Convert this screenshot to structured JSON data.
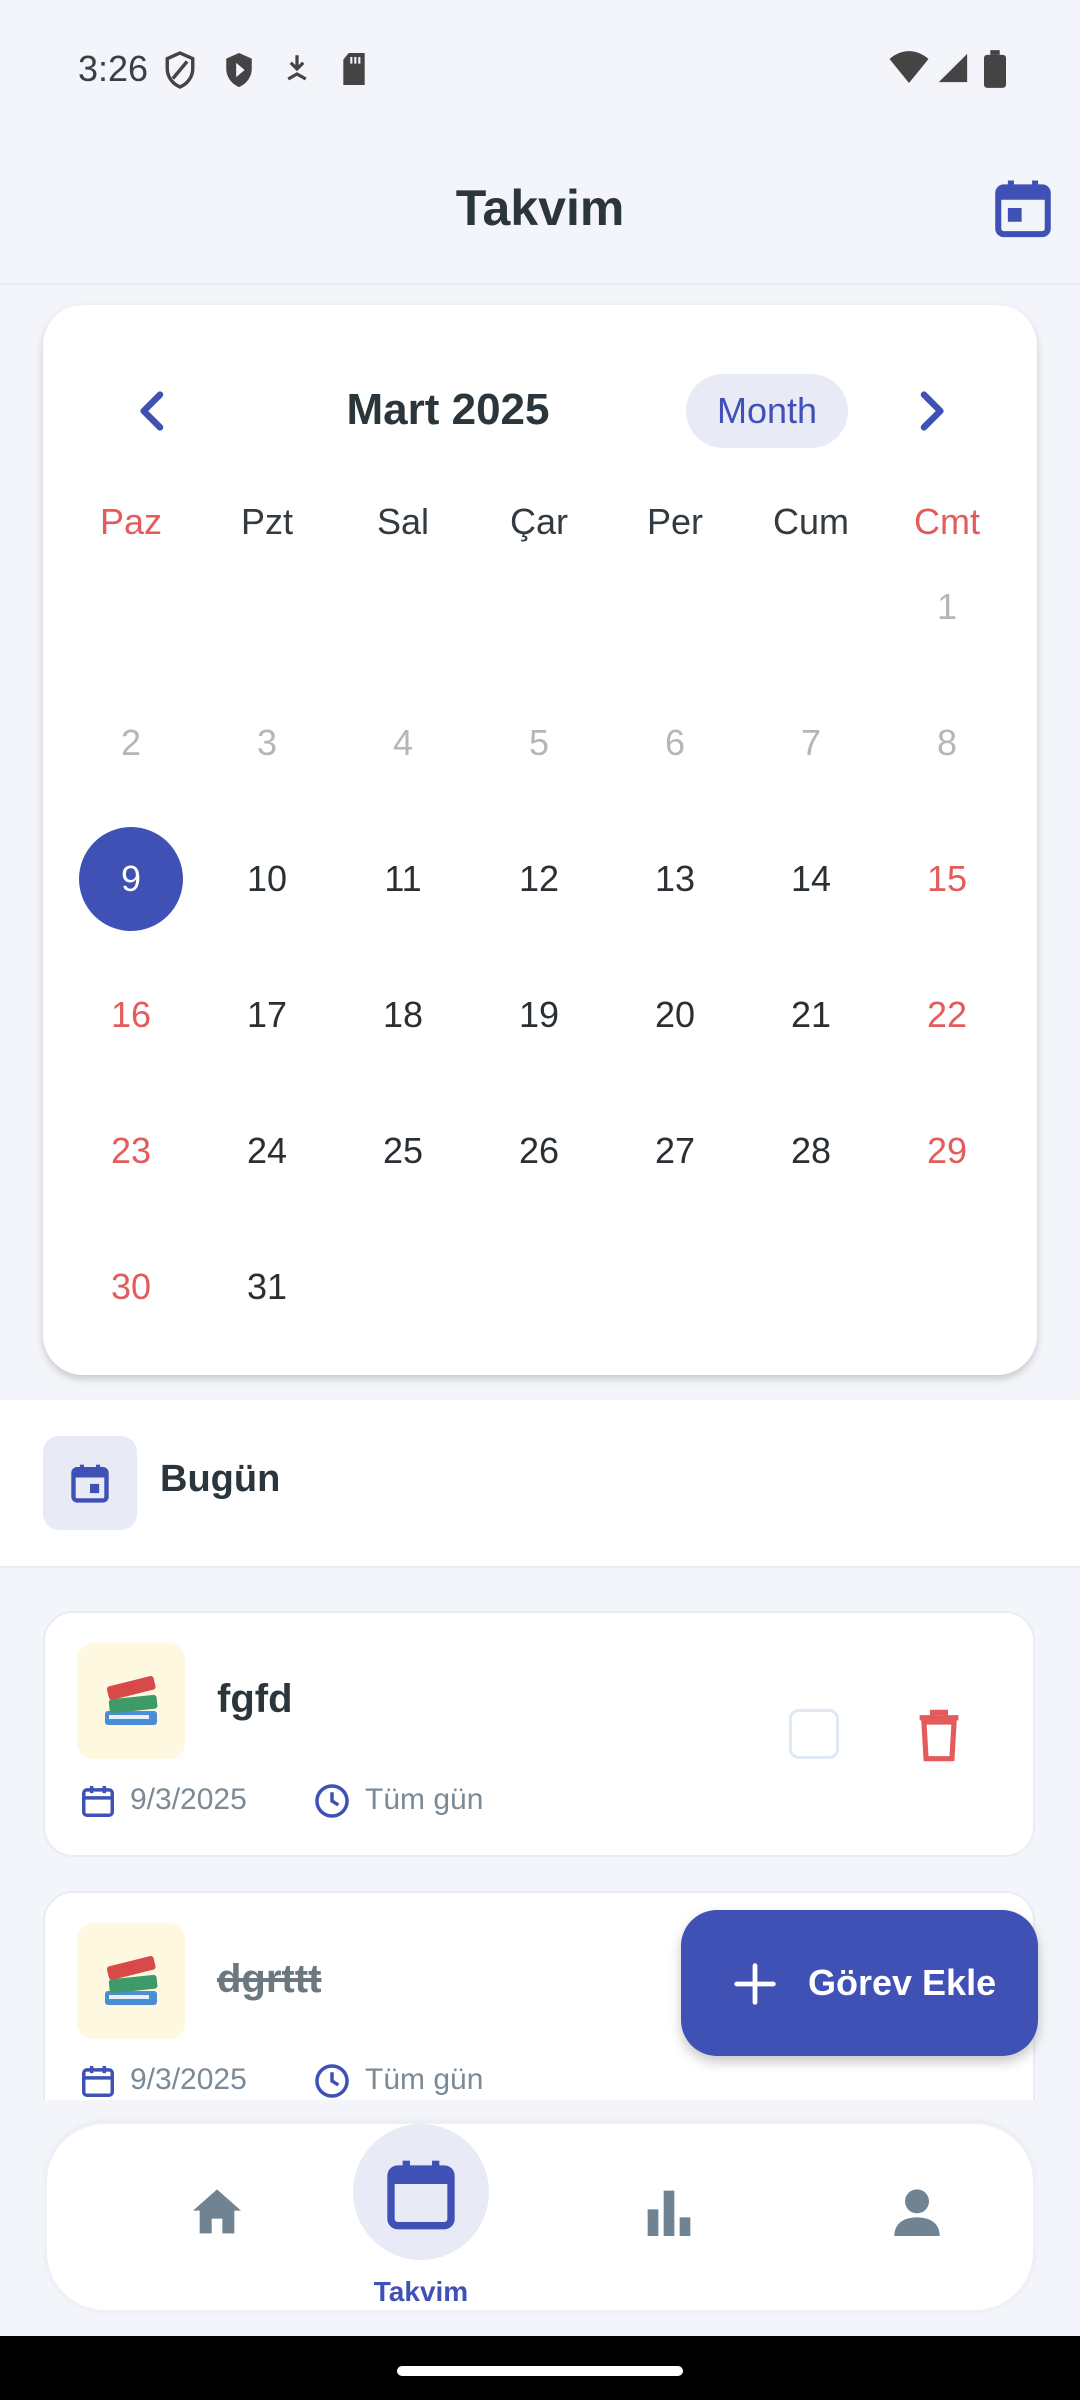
{
  "status_bar": {
    "time": "3:26"
  },
  "header": {
    "title": "Takvim"
  },
  "calendar": {
    "month_label": "Mart 2025",
    "view_toggle": "Month",
    "weekdays": [
      "Paz",
      "Pzt",
      "Sal",
      "Çar",
      "Per",
      "Cum",
      "Cmt"
    ],
    "days": {
      "d1": "1",
      "d2": "2",
      "d3": "3",
      "d4": "4",
      "d5": "5",
      "d6": "6",
      "d7": "7",
      "d8": "8",
      "d9": "9",
      "d10": "10",
      "d11": "11",
      "d12": "12",
      "d13": "13",
      "d14": "14",
      "d15": "15",
      "d16": "16",
      "d17": "17",
      "d18": "18",
      "d19": "19",
      "d20": "20",
      "d21": "21",
      "d22": "22",
      "d23": "23",
      "d24": "24",
      "d25": "25",
      "d26": "26",
      "d27": "27",
      "d28": "28",
      "d29": "29",
      "d30": "30",
      "d31": "31"
    },
    "selected_day": "9"
  },
  "today_section": {
    "label": "Bugün"
  },
  "tasks": [
    {
      "emoji": "📚",
      "title": "fgfd",
      "date": "9/3/2025",
      "time": "Tüm gün",
      "completed": false
    },
    {
      "emoji": "📚",
      "title": "dgrttt",
      "date": "9/3/2025",
      "time": "Tüm gün",
      "completed": true
    }
  ],
  "fab": {
    "label": "Görev Ekle"
  },
  "bottom_nav": {
    "active_label": "Takvim",
    "items": [
      "home-icon",
      "calendar-icon",
      "bar-chart-icon",
      "person-icon"
    ]
  },
  "colors": {
    "primary": "#3f51b5",
    "weekend": "#e35b5b",
    "delete": "#e35b5b",
    "background": "#f3f5fa"
  }
}
